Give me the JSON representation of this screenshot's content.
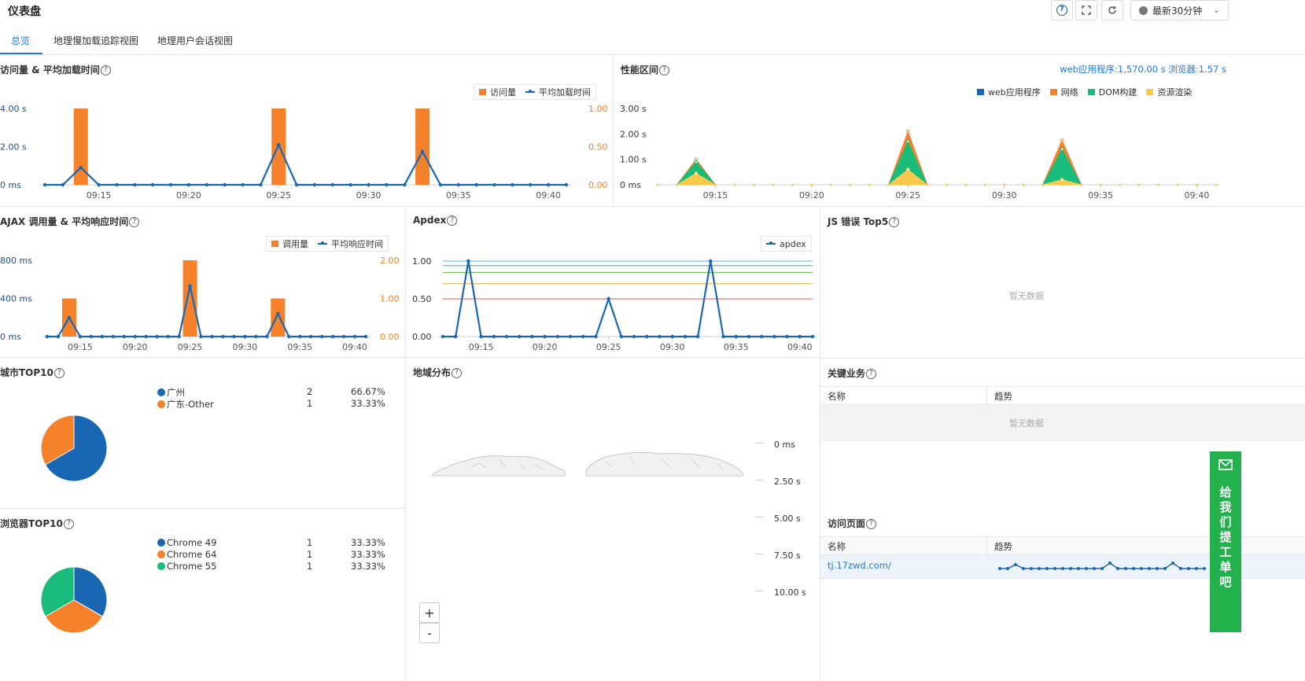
{
  "header": {
    "title": "仪表盘",
    "time_range": "最新30分钟"
  },
  "tabs": [
    "总览",
    "地理慢加载追踪视图",
    "地理用户会话视图"
  ],
  "colors": {
    "accent": "#1f7ae0",
    "orange": "#f5822a",
    "blue": "#1967b3",
    "green": "#1abc7b",
    "yellow": "#f9c94e",
    "feedback": "#22b14c"
  },
  "visits_panel": {
    "title": "访问量 & 平均加载时间",
    "legend": [
      "访问量",
      "平均加载时间"
    ]
  },
  "perf_panel": {
    "title": "性能区间",
    "summary": "web应用程序:1,570.00 s 浏览器:1.57 s",
    "legend": [
      "web应用程序",
      "网络",
      "DOM构建",
      "资源渲染"
    ]
  },
  "ajax_panel": {
    "title": "AJAX 调用量 & 平均响应时间",
    "legend": [
      "调用量",
      "平均响应时间"
    ]
  },
  "apdex_panel": {
    "title": "Apdex",
    "legend": [
      "apdex"
    ]
  },
  "js_panel": {
    "title": "JS 错误 Top5",
    "empty": "暂无数据"
  },
  "city_panel": {
    "title": "城市TOP10",
    "rows": [
      {
        "name": "广州",
        "count": "2",
        "pct": "66.67%"
      },
      {
        "name": "广东-Other",
        "count": "1",
        "pct": "33.33%"
      }
    ]
  },
  "geo_panel": {
    "title": "地域分布",
    "legend": [
      "0 ms",
      "2.50 s",
      "5.00 s",
      "7.50 s",
      "10.00 s"
    ],
    "zoom_in": "+",
    "zoom_out": "-"
  },
  "key_panel": {
    "title": "关键业务",
    "col_name": "名称",
    "col_trend": "趋势",
    "empty": "暂无数据"
  },
  "browser_panel": {
    "title": "浏览器TOP10",
    "rows": [
      {
        "name": "Chrome 49",
        "count": "1",
        "pct": "33.33%"
      },
      {
        "name": "Chrome 64",
        "count": "1",
        "pct": "33.33%"
      },
      {
        "name": "Chrome 55",
        "count": "1",
        "pct": "33.33%"
      }
    ]
  },
  "pages_panel": {
    "title": "访问页面",
    "col_name": "名称",
    "col_trend": "趋势",
    "rows": [
      {
        "name": "tj.17zwd.com/"
      }
    ]
  },
  "feedback": {
    "label": "给我们提工单吧"
  },
  "chart_data": [
    {
      "id": "visits",
      "type": "bar+line",
      "title": "访问量 & 平均加载时间",
      "x_ticks": [
        "09:15",
        "09:20",
        "09:25",
        "09:30",
        "09:35",
        "09:40"
      ],
      "y_left_ticks": [
        "0 ms",
        "2.00 s",
        "4.00 s"
      ],
      "y_right_ticks": [
        "0.00",
        "0.50",
        "1.00"
      ],
      "series": [
        {
          "name": "访问量",
          "type": "bar",
          "points": [
            [
              "09:14",
              1
            ],
            [
              "09:25",
              1
            ],
            [
              "09:33",
              1
            ]
          ]
        },
        {
          "name": "平均加载时间",
          "type": "line",
          "unit": "s",
          "points": [
            [
              "09:12",
              0
            ],
            [
              "09:13",
              0
            ],
            [
              "09:14",
              0.9
            ],
            [
              "09:15",
              0
            ],
            [
              "09:24",
              0
            ],
            [
              "09:25",
              2.1
            ],
            [
              "09:26",
              0
            ],
            [
              "09:32",
              0
            ],
            [
              "09:33",
              1.75
            ],
            [
              "09:34",
              0
            ],
            [
              "09:41",
              0
            ]
          ]
        }
      ]
    },
    {
      "id": "perf",
      "type": "area",
      "title": "性能区间",
      "x_ticks": [
        "09:15",
        "09:20",
        "09:25",
        "09:30",
        "09:35",
        "09:40"
      ],
      "y_ticks": [
        "0 ms",
        "1.00 s",
        "2.00 s",
        "3.00 s"
      ],
      "peaks": [
        {
          "x": "09:14",
          "web应用程序": 0.0,
          "网络": 1.0,
          "DOM构建": 0.9,
          "资源渲染": 0.45
        },
        {
          "x": "09:25",
          "web应用程序": 0.0,
          "网络": 2.1,
          "DOM构建": 1.7,
          "资源渲染": 0.6
        },
        {
          "x": "09:33",
          "web应用程序": 0.0,
          "网络": 1.75,
          "DOM构建": 1.4,
          "资源渲染": 0.2
        }
      ]
    },
    {
      "id": "ajax",
      "type": "bar+line",
      "title": "AJAX 调用量 & 平均响应时间",
      "x_ticks": [
        "09:15",
        "09:20",
        "09:25",
        "09:30",
        "09:35",
        "09:40"
      ],
      "y_left_ticks": [
        "0 ms",
        "400 ms",
        "800 ms"
      ],
      "y_right_ticks": [
        "0.00",
        "1.00",
        "2.00"
      ],
      "series": [
        {
          "name": "调用量",
          "type": "bar",
          "points": [
            [
              "09:14",
              1
            ],
            [
              "09:25",
              2
            ],
            [
              "09:33",
              1
            ]
          ]
        },
        {
          "name": "平均响应时间",
          "type": "line",
          "unit": "ms",
          "points": [
            [
              "09:12",
              0
            ],
            [
              "09:13",
              0
            ],
            [
              "09:14",
              200
            ],
            [
              "09:15",
              0
            ],
            [
              "09:24",
              0
            ],
            [
              "09:25",
              530
            ],
            [
              "09:26",
              0
            ],
            [
              "09:32",
              0
            ],
            [
              "09:33",
              240
            ],
            [
              "09:34",
              0
            ],
            [
              "09:41",
              0
            ]
          ]
        }
      ]
    },
    {
      "id": "apdex",
      "type": "line",
      "title": "Apdex",
      "x_ticks": [
        "09:15",
        "09:20",
        "09:25",
        "09:30",
        "09:35",
        "09:40"
      ],
      "y_ticks": [
        "0.00",
        "0.50",
        "1.00"
      ],
      "series": [
        {
          "name": "apdex",
          "points": [
            [
              "09:12",
              0
            ],
            [
              "09:13",
              0
            ],
            [
              "09:14",
              1.0
            ],
            [
              "09:15",
              0
            ],
            [
              "09:24",
              0
            ],
            [
              "09:25",
              0.5
            ],
            [
              "09:26",
              0
            ],
            [
              "09:32",
              0
            ],
            [
              "09:33",
              1.0
            ],
            [
              "09:34",
              0
            ],
            [
              "09:41",
              0
            ]
          ]
        }
      ],
      "thresholds": [
        0.5,
        0.7,
        0.85,
        0.94,
        1.0
      ]
    },
    {
      "id": "city_pie",
      "type": "pie",
      "title": "城市TOP10",
      "labels": [
        "广州",
        "广东-Other"
      ],
      "values": [
        66.67,
        33.33
      ]
    },
    {
      "id": "browser_pie",
      "type": "pie",
      "title": "浏览器TOP10",
      "labels": [
        "Chrome 49",
        "Chrome 64",
        "Chrome 55"
      ],
      "values": [
        33.33,
        33.33,
        33.33
      ]
    }
  ]
}
